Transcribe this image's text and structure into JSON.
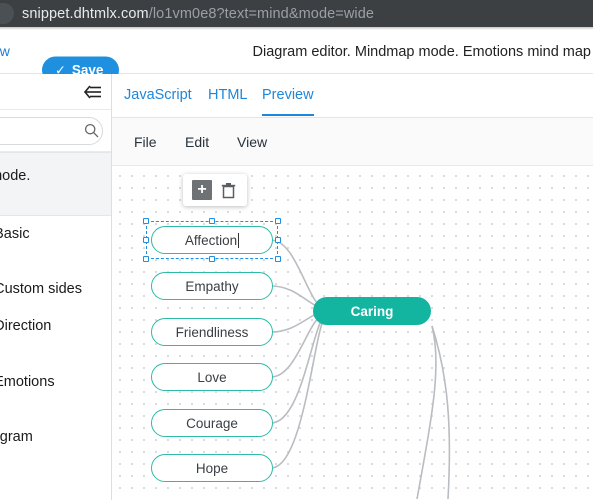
{
  "browser": {
    "url_prefix": "snippet.dhtmlx.com",
    "url_suffix": "/lo1vm0e8?text=mind&mode=wide"
  },
  "toolbar": {
    "new_label": "ew",
    "save_label": "Save",
    "save_check_icon": "✓",
    "page_title": "Diagram editor. Mindmap mode. Emotions mind map",
    "accent_color": "#1e90df"
  },
  "sidebar": {
    "collapse_icon": "collapse-left-icon",
    "search": {
      "value": "",
      "placeholder": ""
    },
    "items": [
      {
        "label": "p mode.",
        "active": true
      },
      {
        "label": "e. Basic",
        "active": false
      },
      {
        "label": "e. Custom sides",
        "active": false
      },
      {
        "label": "e. Direction",
        "active": false
      },
      {
        "label": "e. Emotions",
        "active": false
      },
      {
        "label": "Diagram",
        "active": false
      }
    ]
  },
  "editor": {
    "tabs": [
      {
        "label": "JavaScript",
        "active": false
      },
      {
        "label": "HTML",
        "active": false
      },
      {
        "label": "Preview",
        "active": true
      }
    ],
    "menu": [
      {
        "label": "File"
      },
      {
        "label": "Edit"
      },
      {
        "label": "View"
      }
    ]
  },
  "node_toolbar": {
    "add_icon": "plus-icon",
    "add_glyph": "+",
    "delete_icon": "trash-icon"
  },
  "mindmap": {
    "root_color": "#13b5a0",
    "node_border_color": "#2bbba6",
    "selection_color": "#1f8fe0",
    "editing_node": "Affection",
    "nodes": [
      {
        "label": "Affection",
        "editing": true
      },
      {
        "label": "Empathy",
        "editing": false
      },
      {
        "label": "Friendliness",
        "editing": false
      },
      {
        "label": "Love",
        "editing": false
      },
      {
        "label": "Courage",
        "editing": false
      },
      {
        "label": "Hope",
        "editing": false
      }
    ],
    "root": {
      "label": "Caring"
    }
  }
}
